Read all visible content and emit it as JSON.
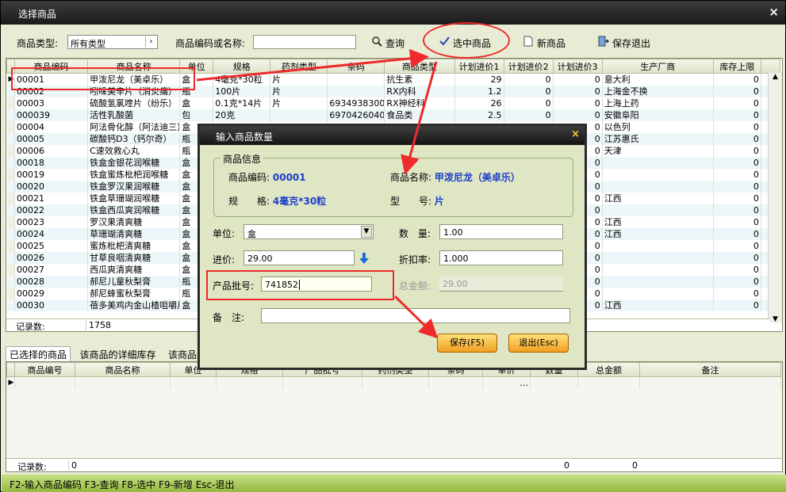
{
  "window": {
    "title": "选择商品",
    "close_glyph": "×"
  },
  "toolbar": {
    "type_label": "商品类型:",
    "type_value": "所有类型",
    "search_label": "商品编码或名称:",
    "search_value": "",
    "query_label": "查询",
    "select_label": "选中商品",
    "new_label": "新商品",
    "save_exit_label": "保存退出"
  },
  "product_grid": {
    "columns": [
      "商品编码",
      "商品名称",
      "单位",
      "规格",
      "药剂类型",
      "条码",
      "商品类型",
      "计划进价1",
      "计划进价2",
      "计划进价3",
      "生产厂商",
      "库存上限"
    ],
    "rows": [
      [
        "00001",
        "甲泼尼龙（美卓乐）",
        "盒",
        "4毫克*30粒",
        "片",
        "",
        "抗生素",
        "29",
        "0",
        "0",
        "意大利",
        "0"
      ],
      [
        "00002",
        "吲哚美辛片（消炎痛）",
        "瓶",
        "100片",
        "片",
        "",
        "RX内科",
        "1.2",
        "0",
        "0",
        "上海金不换",
        "0"
      ],
      [
        "00003",
        "硫酸氢氯喹片（纷乐）",
        "盒",
        "0.1克*14片",
        "片",
        "69349383000",
        "RX神经科",
        "26",
        "0",
        "0",
        "上海上药",
        "0"
      ],
      [
        "000039",
        "活性乳酸菌",
        "包",
        "20克",
        "",
        "69704260402",
        "食品类",
        "2.5",
        "0",
        "0",
        "安徽阜阳",
        "0"
      ],
      [
        "00004",
        "阿法骨化醇（阿法迪三）",
        "盒",
        "",
        "",
        "",
        "",
        "",
        "",
        "0",
        "以色列",
        "0"
      ],
      [
        "00005",
        "碳酸钙D3（钙尔奇）",
        "瓶",
        "",
        "",
        "",
        "",
        "",
        "",
        "0",
        "江苏惠氏",
        "0"
      ],
      [
        "00006",
        "C速效救心丸",
        "瓶",
        "",
        "",
        "",
        "",
        "",
        "",
        "0",
        "天津",
        "0"
      ],
      [
        "00018",
        "铁盒金银花润喉糖",
        "盒",
        "",
        "",
        "",
        "",
        "",
        "",
        "0",
        "",
        "0"
      ],
      [
        "00019",
        "铁盒蜜炼枇杷润喉糖",
        "盒",
        "",
        "",
        "",
        "",
        "",
        "",
        "0",
        "",
        "0"
      ],
      [
        "00020",
        "铁盒罗汉果润喉糖",
        "盒",
        "",
        "",
        "",
        "",
        "",
        "",
        "0",
        "",
        "0"
      ],
      [
        "00021",
        "铁盒草珊瑚润喉糖",
        "盒",
        "",
        "",
        "",
        "",
        "",
        "",
        "0",
        "江西",
        "0"
      ],
      [
        "00022",
        "铁盒西瓜爽润喉糖",
        "盒",
        "",
        "",
        "",
        "",
        "",
        "",
        "0",
        "",
        "0"
      ],
      [
        "00023",
        "罗汉果清爽糖",
        "盒",
        "",
        "",
        "",
        "",
        "",
        "",
        "0",
        "江西",
        "0"
      ],
      [
        "00024",
        "草珊瑚清爽糖",
        "盒",
        "",
        "",
        "",
        "",
        "",
        "",
        "0",
        "江西",
        "0"
      ],
      [
        "00025",
        "蜜炼枇杷清爽糖",
        "盒",
        "",
        "",
        "",
        "",
        "",
        "",
        "0",
        "",
        "0"
      ],
      [
        "00026",
        "甘草良咽清爽糖",
        "盒",
        "",
        "",
        "",
        "",
        "",
        "",
        "0",
        "",
        "0"
      ],
      [
        "00027",
        "西瓜爽清爽糖",
        "盒",
        "",
        "",
        "",
        "",
        "",
        "",
        "0",
        "",
        "0"
      ],
      [
        "00028",
        "郝尼儿童秋梨膏",
        "瓶",
        "",
        "",
        "",
        "",
        "",
        "",
        "0",
        "",
        "0"
      ],
      [
        "00029",
        "郝尼蜂蜜秋梨膏",
        "瓶",
        "",
        "",
        "",
        "",
        "",
        "",
        "0",
        "",
        "0"
      ],
      [
        "00030",
        "蓓多美鸡内金山楂咀嚼片",
        "盒",
        "",
        "",
        "",
        "",
        "",
        "",
        "0",
        "江西",
        "0"
      ]
    ],
    "record_label": "记录数:",
    "record_count": "1758"
  },
  "tabs": [
    "已选择的商品",
    "该商品的详细库存",
    "该商品进"
  ],
  "selected_grid": {
    "columns": [
      "商品编号",
      "商品名称",
      "单位",
      "规格",
      "产品批号",
      "药剂类型",
      "条码",
      "单价",
      "数量",
      "总金额",
      "备注"
    ],
    "record_label": "记录数:",
    "record_count": "0",
    "qty_total": "0",
    "amount_total": "0"
  },
  "status_bar": "F2-输入商品编码 F3-查询 F8-选中 F9-新增 Esc-退出",
  "dialog": {
    "title": "输入商品数量",
    "close_glyph": "×",
    "group_label": "商品信息",
    "code_label": "商品编码:",
    "code_value": "00001",
    "name_label": "商品名称:",
    "name_value": "甲泼尼龙（美卓乐）",
    "spec_label": "规　　格:",
    "spec_value": "4毫克*30粒",
    "model_label": "型　　号:",
    "model_value": "片",
    "unit_label": "单位:",
    "unit_value": "盒",
    "qty_label": "数　量:",
    "qty_value": "1.00",
    "price_label": "进价:",
    "price_value": "29.00",
    "discount_label": "折扣率:",
    "discount_value": "1.000",
    "batch_label": "产品批号:",
    "batch_value": "741852",
    "total_label": "总金额:",
    "total_value": "29.00",
    "note_label": "备　注:",
    "note_value": "",
    "save_label": "保存(F5)",
    "exit_label": "退出(Esc)"
  },
  "colors": {
    "accent_red": "#ee2a2a",
    "status_green": "#a7c84e",
    "link_blue": "#1d3ec8"
  }
}
